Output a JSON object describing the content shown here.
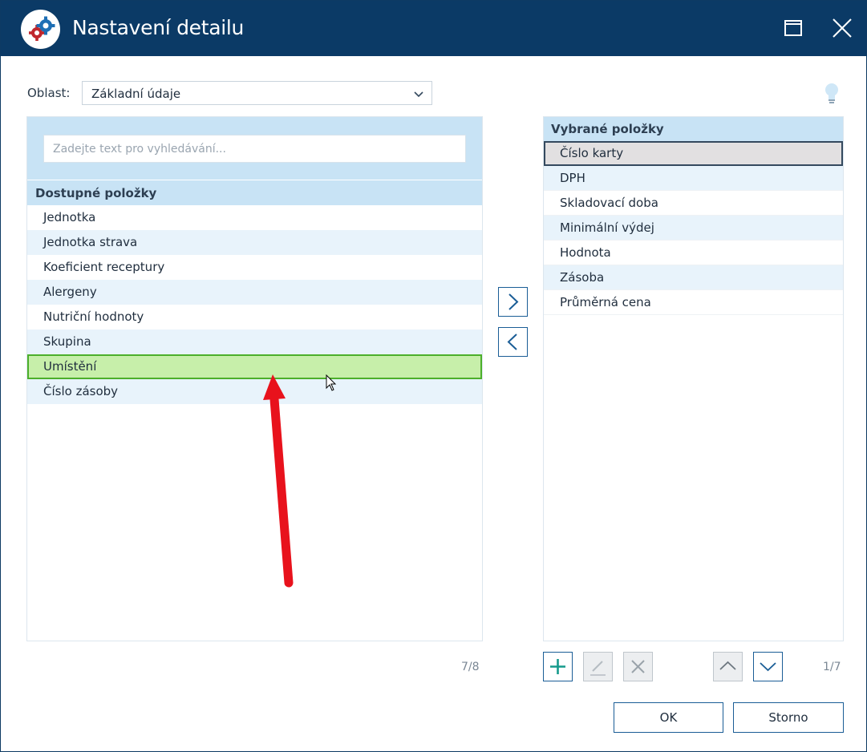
{
  "window": {
    "title": "Nastavení detailu",
    "icons": [
      "gears-icon",
      "maximize-icon",
      "close-icon"
    ]
  },
  "filter": {
    "label": "Oblast:",
    "value": "Základní údaje"
  },
  "available": {
    "search_placeholder": "Zadejte text pro vyhledávání...",
    "header": "Dostupné položky",
    "items": [
      "Jednotka",
      "Jednotka strava",
      "Koeficient receptury",
      "Alergeny",
      "Nutriční hodnoty",
      "Skupina",
      "Umístění",
      "Číslo zásoby"
    ],
    "selected_index": 6,
    "count": "7/8"
  },
  "selected": {
    "header": "Vybrané položky",
    "items": [
      "Číslo karty",
      "DPH",
      "Skladovací doba",
      "Minimální výdej",
      "Hodnota",
      "Zásoba",
      "Průměrná cena"
    ],
    "active_index": 0,
    "count": "1/7"
  },
  "buttons": {
    "ok": "OK",
    "cancel": "Storno"
  },
  "colors": {
    "titlebar": "#0b3a66",
    "panel_header": "#c8e3f5",
    "row_alt": "#e8f3fb",
    "selection_green": "#c7efaa",
    "accent": "#1a5d96",
    "annotation_arrow": "#e8121c"
  }
}
